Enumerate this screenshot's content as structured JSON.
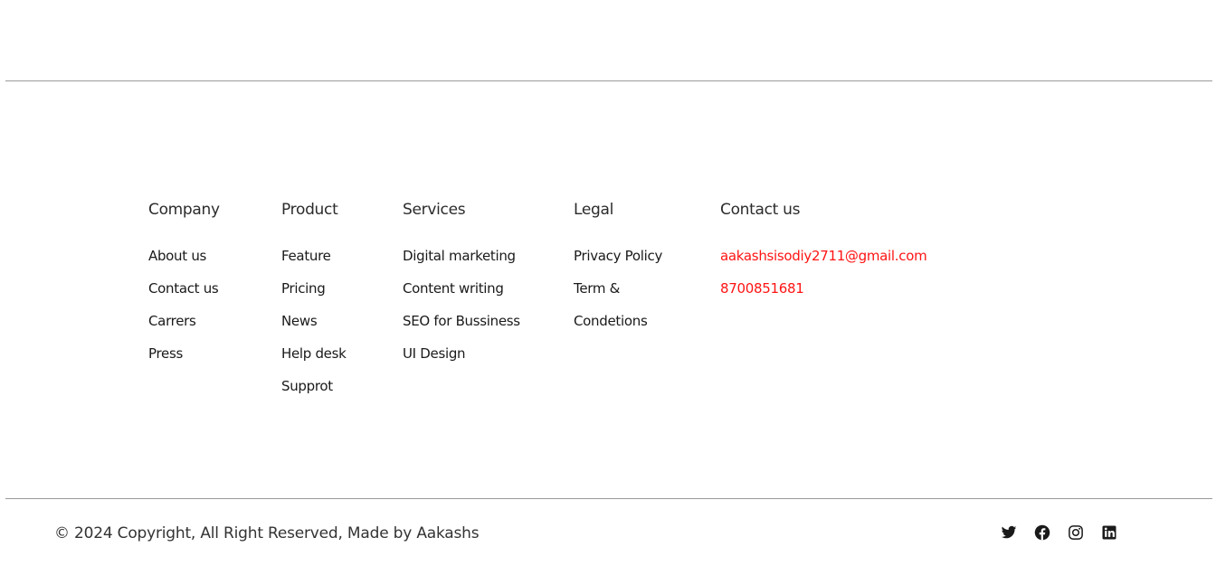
{
  "footer": {
    "columns": [
      {
        "heading": "Company",
        "items": [
          "About us",
          "Contact us",
          "Carrers",
          "Press"
        ]
      },
      {
        "heading": "Product",
        "items": [
          "Feature",
          "Pricing",
          "News",
          "Help desk",
          "Supprot"
        ]
      },
      {
        "heading": "Services",
        "items": [
          "Digital marketing",
          "Content writing",
          "SEO for Bussiness",
          "UI Design"
        ]
      },
      {
        "heading": "Legal",
        "items": [
          "Privacy Policy",
          "Term &",
          "Condetions"
        ]
      },
      {
        "heading": "Contact us",
        "items": [
          "aakashsisodiy2711@gmail.com",
          "8700851681"
        ]
      }
    ],
    "copyright": "© 2024 Copyright, All Right Reserved, Made by Aakashs",
    "social": [
      {
        "name": "twitter-icon"
      },
      {
        "name": "facebook-icon"
      },
      {
        "name": "instagram-icon"
      },
      {
        "name": "linkedin-icon"
      }
    ]
  },
  "colors": {
    "contact_accent": "#ff1414",
    "divider": "#9a9a9a",
    "text": "#1a1a1a"
  }
}
